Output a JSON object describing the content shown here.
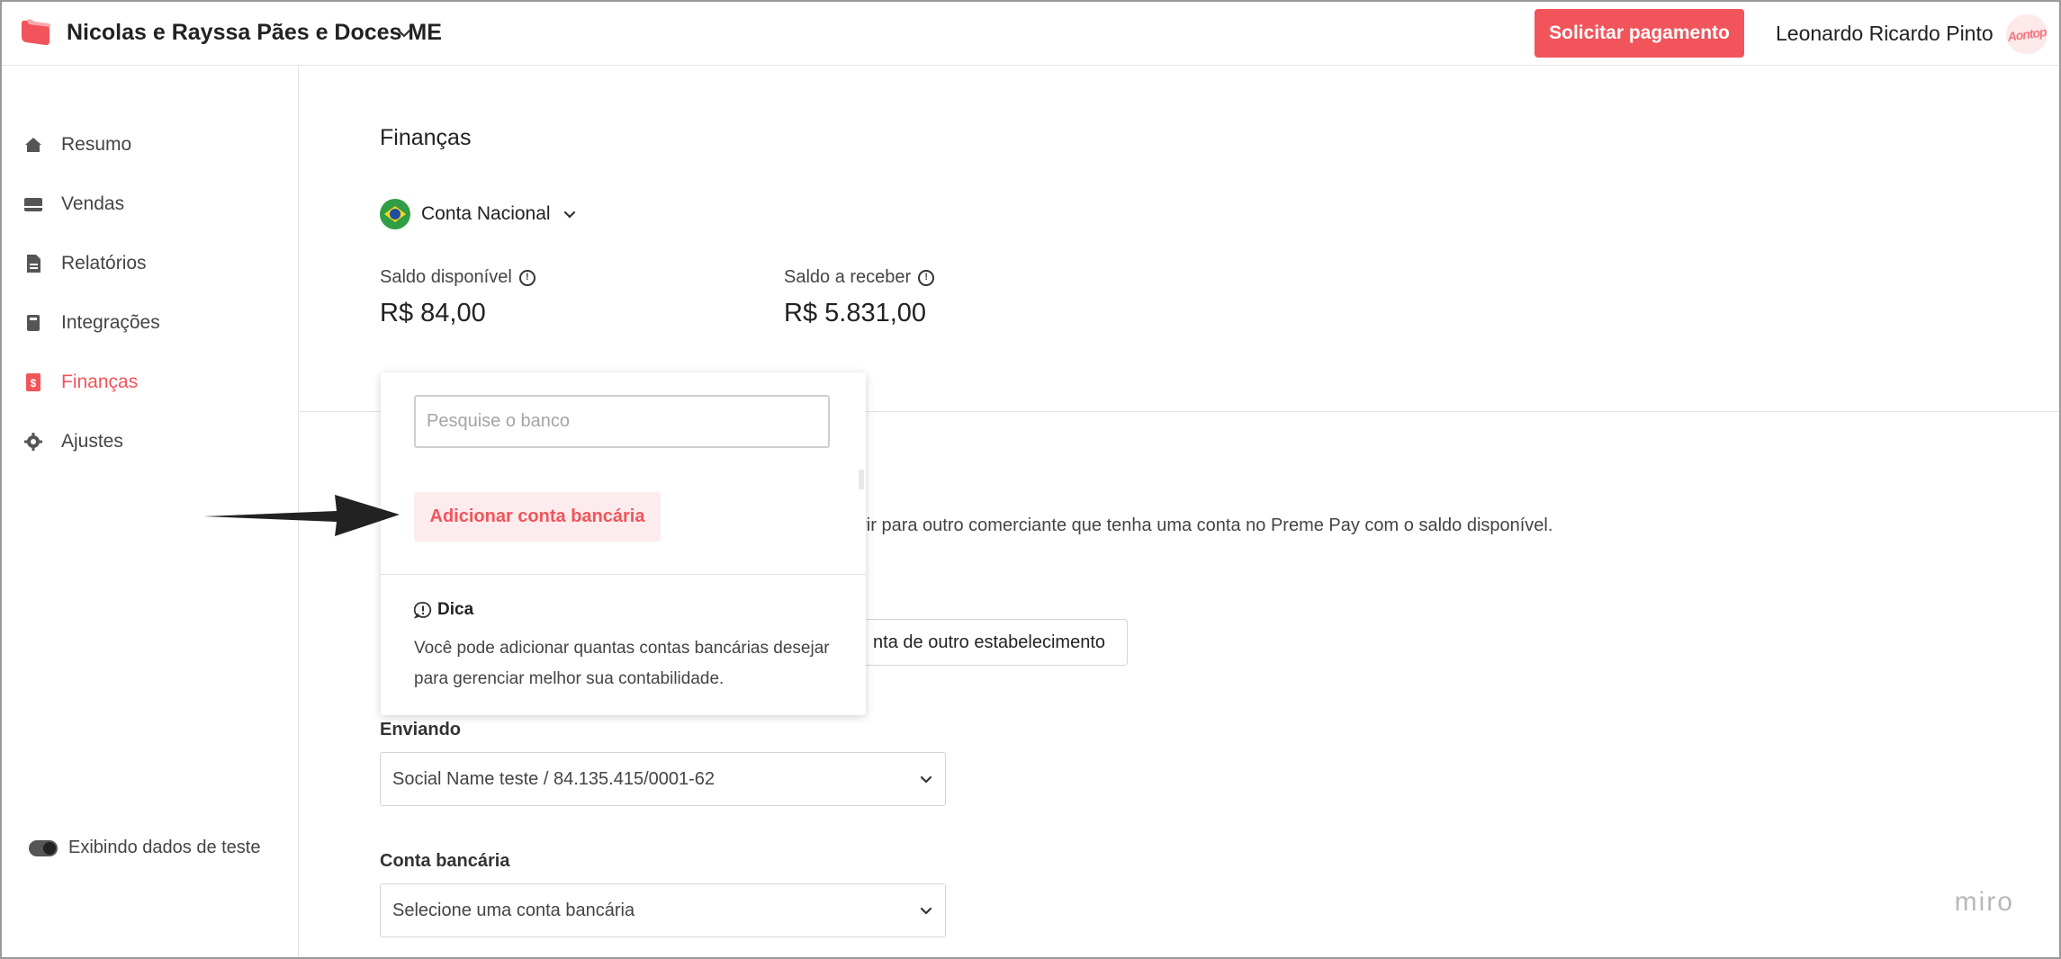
{
  "header": {
    "company_name": "Nicolas e Rayssa Pães e Doces ME",
    "request_payment_label": "Solicitar pagamento",
    "user_name": "Leonardo Ricardo Pinto",
    "avatar_text": "Aontop"
  },
  "sidebar": {
    "items": [
      {
        "label": "Resumo",
        "icon": "home-icon"
      },
      {
        "label": "Vendas",
        "icon": "sales-icon"
      },
      {
        "label": "Relatórios",
        "icon": "report-icon"
      },
      {
        "label": "Integrações",
        "icon": "integrations-icon"
      },
      {
        "label": "Finanças",
        "icon": "finance-icon",
        "active": true
      },
      {
        "label": "Ajustes",
        "icon": "gear-icon"
      }
    ],
    "test_data_label": "Exibindo dados de teste"
  },
  "main": {
    "title": "Finanças",
    "account_label": "Conta Nacional",
    "available_balance_label": "Saldo disponível",
    "available_balance_value": "R$ 84,00",
    "receivable_balance_label": "Saldo a receber",
    "receivable_balance_value": "R$ 5.831,00",
    "description_partial": "erir para outro comerciante que tenha uma conta no Preme Pay com o saldo disponível.",
    "other_establishment_button_partial": "nta de outro estabelecimento",
    "sending_label": "Enviando",
    "sending_value": "Social Name teste / 84.135.415/0001-62",
    "bank_account_label": "Conta bancária",
    "bank_account_placeholder": "Selecione uma conta bancária",
    "watermark": "miro"
  },
  "popover": {
    "search_placeholder": "Pesquise o banco",
    "add_bank_label": "Adicionar conta bancária",
    "tip_title": "Dica",
    "tip_text": "Você pode adicionar quantas contas bancárias desejar para gerenciar melhor sua contabilidade."
  },
  "colors": {
    "accent": "#f2545b",
    "accent_light": "#fdeced"
  }
}
